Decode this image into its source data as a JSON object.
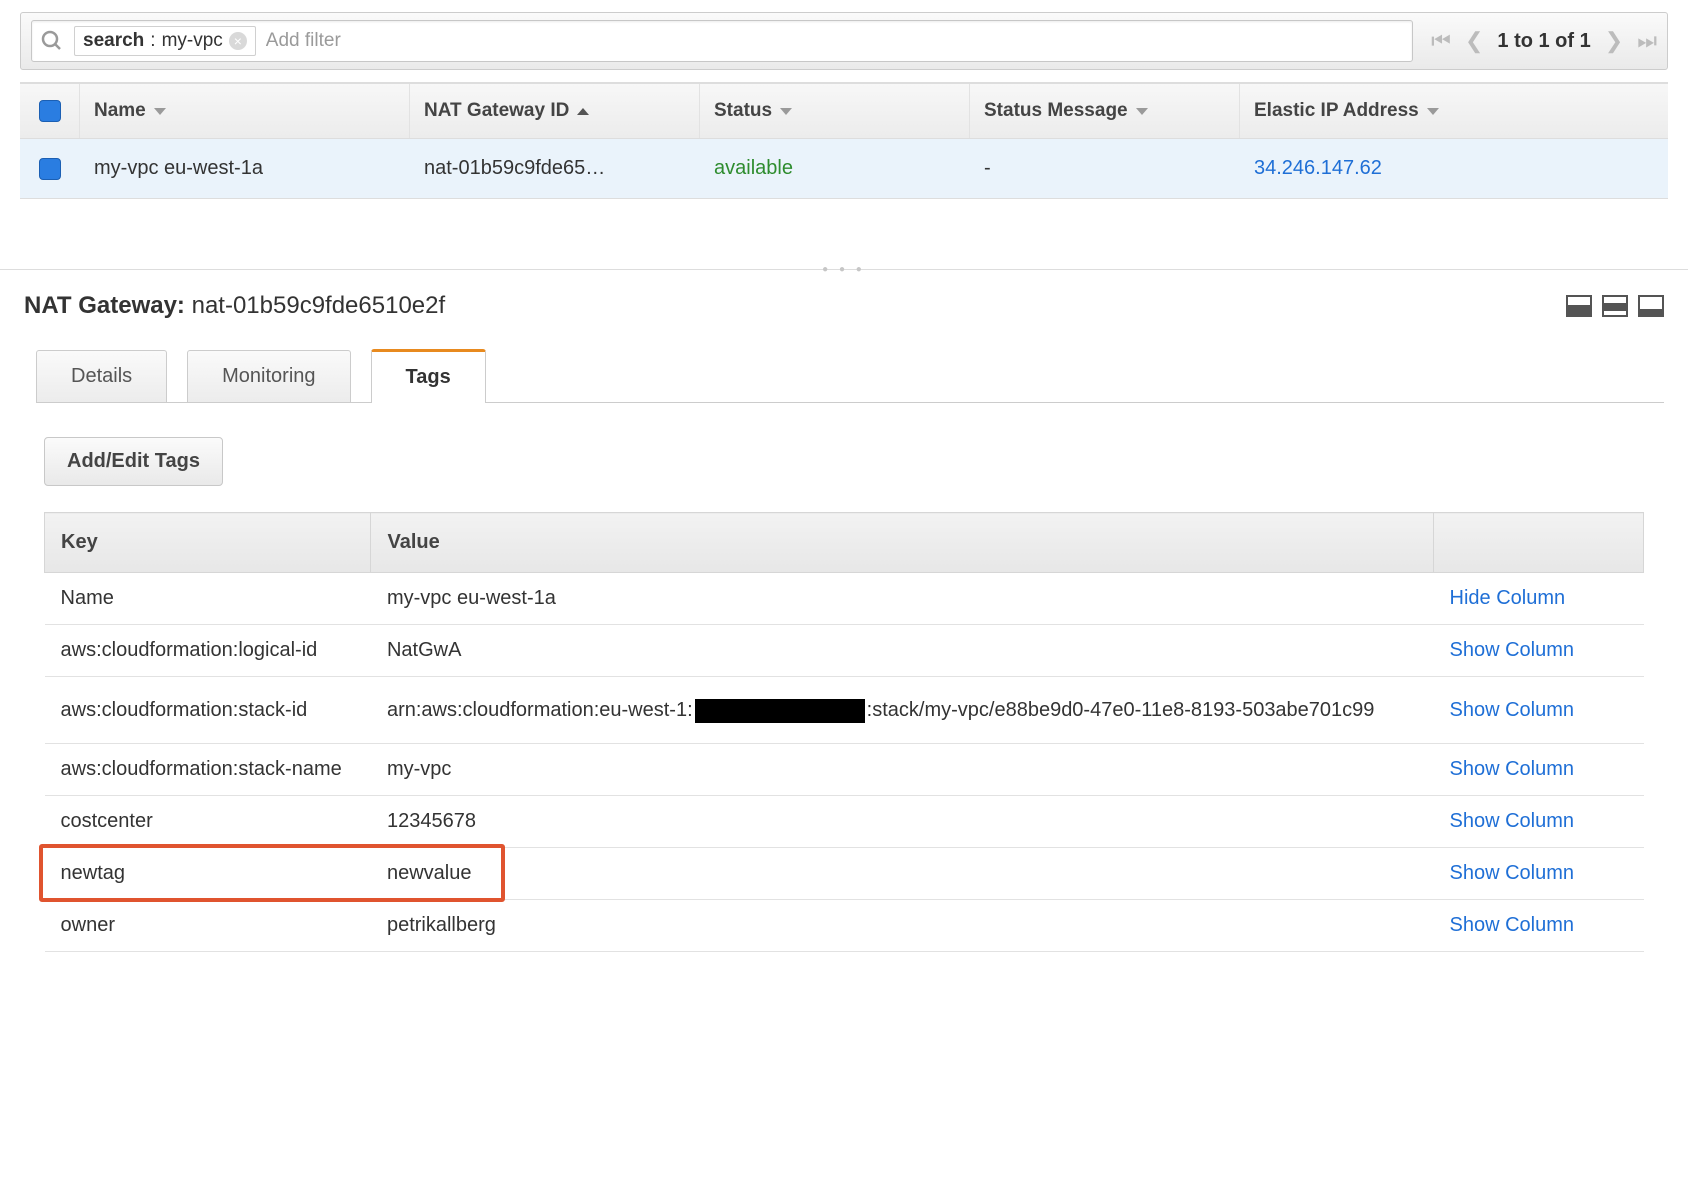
{
  "search": {
    "chip_key": "search",
    "chip_value": "my-vpc",
    "placeholder": "Add filter"
  },
  "pager": {
    "range": "1 to 1 of 1"
  },
  "columns": {
    "name": "Name",
    "natgw": "NAT Gateway ID",
    "status": "Status",
    "status_msg": "Status Message",
    "eip": "Elastic IP Address"
  },
  "row": {
    "name": "my-vpc eu-west-1a",
    "natgw": "nat-01b59c9fde65…",
    "status": "available",
    "status_msg": "-",
    "eip": "34.246.147.62"
  },
  "panel": {
    "label": "NAT Gateway:",
    "id": "nat-01b59c9fde6510e2f"
  },
  "tabs": {
    "details": "Details",
    "monitoring": "Monitoring",
    "tags": "Tags"
  },
  "tags": {
    "button": "Add/Edit Tags",
    "head_key": "Key",
    "head_value": "Value",
    "hide": "Hide Column",
    "show": "Show Column",
    "rows": [
      {
        "k": "Name",
        "v": "my-vpc eu-west-1a",
        "a": "Hide Column"
      },
      {
        "k": "aws:cloudformation:logical-id",
        "v": "NatGwA",
        "a": "Show Column"
      },
      {
        "k": "aws:cloudformation:stack-id",
        "v_pre": "arn:aws:cloudformation:eu-west-1:",
        "v_post": ":stack/my-vpc/e88be9d0-47e0-11e8-8193-503abe701c99",
        "a": "Show Column"
      },
      {
        "k": "aws:cloudformation:stack-name",
        "v": "my-vpc",
        "a": "Show Column"
      },
      {
        "k": "costcenter",
        "v": "12345678",
        "a": "Show Column"
      },
      {
        "k": "newtag",
        "v": "newvalue",
        "a": "Show Column"
      },
      {
        "k": "owner",
        "v": "petrikallberg",
        "a": "Show Column"
      }
    ]
  }
}
